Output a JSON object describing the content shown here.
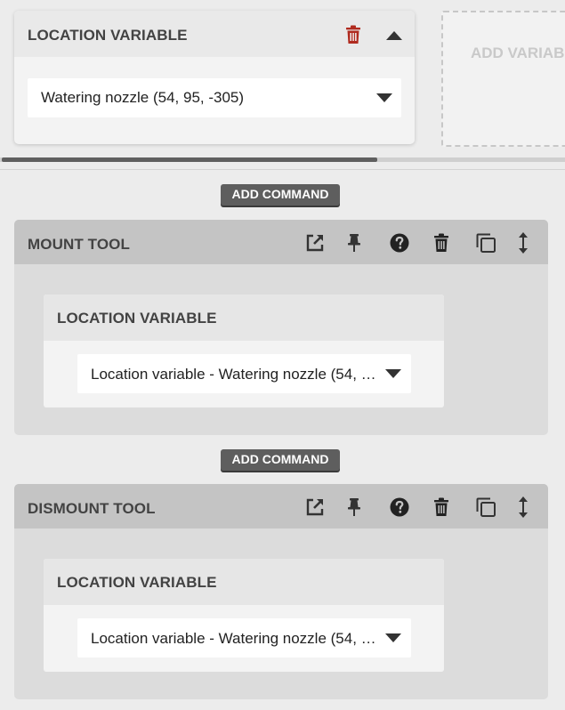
{
  "variable_card": {
    "title": "LOCATION VARIABLE",
    "selected_value": "Watering nozzle (54, 95, -305)"
  },
  "add_variable_label": "ADD VARIABLE",
  "add_command_label": "ADD COMMAND",
  "steps": [
    {
      "title": "MOUNT TOOL",
      "inner_title": "LOCATION VARIABLE",
      "selected_value": "Location variable - Watering nozzle (54, …"
    },
    {
      "title": "DISMOUNT TOOL",
      "inner_title": "LOCATION VARIABLE",
      "selected_value": "Location variable - Watering nozzle (54, …"
    }
  ],
  "colors": {
    "trash_red": "#b02b1f",
    "button_dark": "#5e5e5e",
    "header_gray": "#c4c4c4",
    "step_bg": "#dcdcdc"
  },
  "icons": [
    "trash-icon",
    "caret-up-icon",
    "caret-down-icon",
    "external-link-icon",
    "pin-icon",
    "help-icon",
    "duplicate-icon",
    "drag-handle-icon"
  ]
}
